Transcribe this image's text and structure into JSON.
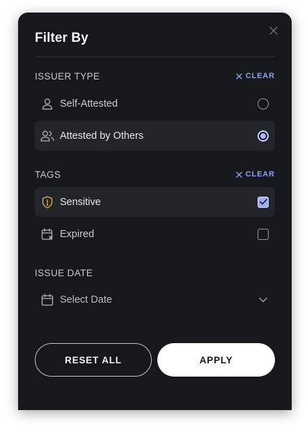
{
  "panel": {
    "title": "Filter By"
  },
  "issuer_type": {
    "title": "ISSUER TYPE",
    "clear_label": "CLEAR",
    "options": [
      {
        "label": "Self-Attested",
        "icon": "user-icon",
        "selected": false
      },
      {
        "label": "Attested by Others",
        "icon": "users-icon",
        "selected": true
      }
    ]
  },
  "tags": {
    "title": "TAGS",
    "clear_label": "CLEAR",
    "options": [
      {
        "label": "Sensitive",
        "icon": "shield-alert-icon",
        "checked": true
      },
      {
        "label": "Expired",
        "icon": "calendar-x-icon",
        "checked": false
      }
    ]
  },
  "issue_date": {
    "title": "ISSUE DATE",
    "placeholder": "Select Date",
    "icon": "calendar-icon"
  },
  "actions": {
    "reset_label": "RESET ALL",
    "apply_label": "APPLY"
  },
  "colors": {
    "panel_bg": "#17181c",
    "row_active_bg": "#23252b",
    "accent": "#8fa0f2",
    "warning_icon": "#e0b64a"
  }
}
